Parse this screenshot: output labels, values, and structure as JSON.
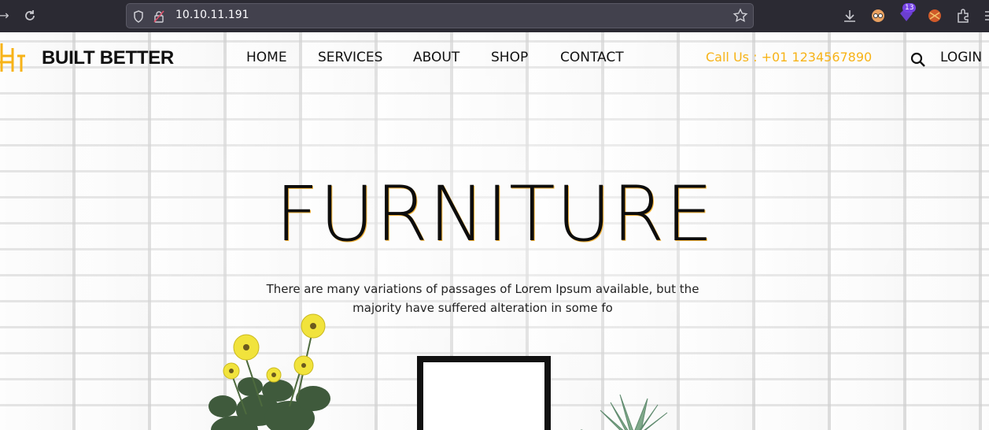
{
  "browser": {
    "url": "10.10.11.191",
    "extension_badge": "13"
  },
  "header": {
    "brand": "BUILT BETTER",
    "nav": [
      "HOME",
      "SERVICES",
      "ABOUT",
      "SHOP",
      "CONTACT"
    ],
    "call": "Call Us : +01 1234567890",
    "login": "LOGIN"
  },
  "hero": {
    "title": "FURNITURE",
    "text": "There are many variations of passages of Lorem Ipsum available, but the majority have suffered alteration in some fo"
  },
  "colors": {
    "accent": "#f7b318",
    "chrome_bg": "#2b2a33"
  },
  "icons": [
    "back-icon",
    "reload-icon",
    "shield-icon",
    "lock-icon",
    "star-icon",
    "download-icon",
    "extension-icon",
    "puzzle-icon",
    "menu-icon",
    "search-icon",
    "chair-logo-icon"
  ]
}
